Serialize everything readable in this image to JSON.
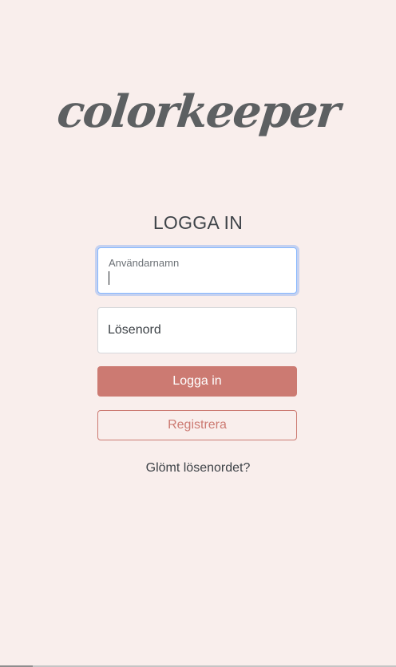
{
  "logo": {
    "text": "colorkeeper"
  },
  "heading": "LOGGA IN",
  "username": {
    "label": "Användarnamn",
    "value": ""
  },
  "password": {
    "placeholder": "Lösenord",
    "value": ""
  },
  "buttons": {
    "login": "Logga in",
    "register": "Registrera"
  },
  "forgot_link": "Glömt lösenordet?",
  "colors": {
    "background": "#f9eeec",
    "accent": "#cc7a72",
    "logo": "#5d6062",
    "focus_ring": "#86b7fe"
  }
}
